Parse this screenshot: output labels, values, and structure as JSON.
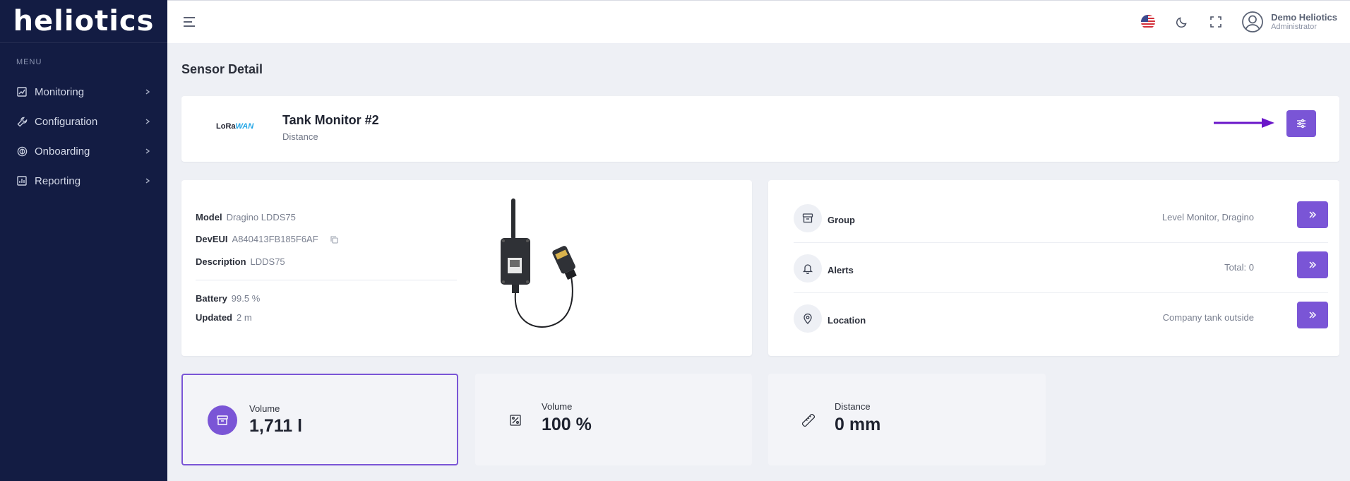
{
  "app": {
    "logo_text": "heliotics"
  },
  "sidebar": {
    "menu_title": "MENU",
    "items": [
      {
        "label": "Monitoring",
        "icon": "chart-line-icon"
      },
      {
        "label": "Configuration",
        "icon": "wrench-icon"
      },
      {
        "label": "Onboarding",
        "icon": "onboarding-icon"
      },
      {
        "label": "Reporting",
        "icon": "bar-chart-icon"
      }
    ]
  },
  "topbar": {
    "user_name": "Demo Heliotics",
    "user_role": "Administrator"
  },
  "page": {
    "title": "Sensor Detail"
  },
  "sensor": {
    "network_logo_lora": "LoRa",
    "network_logo_wan": "WAN",
    "name": "Tank Monitor #2",
    "type": "Distance"
  },
  "info": {
    "model_label": "Model",
    "model_value": "Dragino LDDS75",
    "deveui_label": "DevEUI",
    "deveui_value": "A840413FB185F6AF",
    "description_label": "Description",
    "description_value": "LDDS75",
    "battery_label": "Battery",
    "battery_value": "99.5 %",
    "updated_label": "Updated",
    "updated_value": "2 m"
  },
  "details": {
    "group_label": "Group",
    "group_value": "Level Monitor, Dragino",
    "alerts_label": "Alerts",
    "alerts_value": "Total: 0",
    "location_label": "Location",
    "location_value": "Company tank outside"
  },
  "stats": [
    {
      "label": "Volume",
      "value": "1,711 l",
      "icon": "box-icon"
    },
    {
      "label": "Volume",
      "value": "100 %",
      "icon": "percent-icon"
    },
    {
      "label": "Distance",
      "value": "0 mm",
      "icon": "ruler-icon"
    }
  ],
  "colors": {
    "accent": "#7a55d6",
    "sidebar": "#131c43",
    "arrow": "#6a16c9"
  }
}
